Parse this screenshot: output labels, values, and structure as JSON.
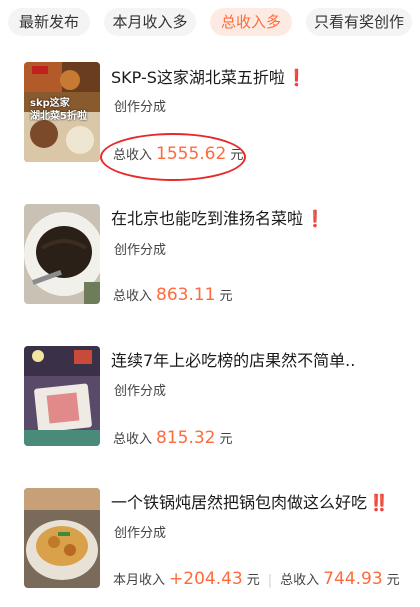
{
  "tabs": [
    {
      "label": "最新发布"
    },
    {
      "label": "本月收入多"
    },
    {
      "label": "总收入多",
      "active": true
    },
    {
      "label": "只看有奖创作"
    }
  ],
  "items": [
    {
      "title": "SKP-S这家湖北菜五折啦",
      "excl": "❗",
      "tag": "创作分成",
      "total_label": "总收入",
      "total_amount": "1555.62",
      "unit": "元",
      "thumb_caption_1": "skp这家",
      "thumb_caption_2": "湖北菜5折啦"
    },
    {
      "title": "在北京也能吃到淮扬名菜啦",
      "excl": "❗",
      "tag": "创作分成",
      "total_label": "总收入",
      "total_amount": "863.11",
      "unit": "元"
    },
    {
      "title": "连续7年上必吃榜的店果然不简单..",
      "tag": "创作分成",
      "total_label": "总收入",
      "total_amount": "815.32",
      "unit": "元"
    },
    {
      "title": "一个铁锅炖居然把锅包肉做这么好吃",
      "excl": "‼️",
      "tag": "创作分成",
      "month_label": "本月收入",
      "month_amount": "+204.43",
      "month_unit": "元",
      "total_label": "总收入",
      "total_amount": "744.93",
      "unit": "元"
    }
  ],
  "colors": {
    "accent": "#ff6a3d",
    "annotation": "#e8292b"
  }
}
